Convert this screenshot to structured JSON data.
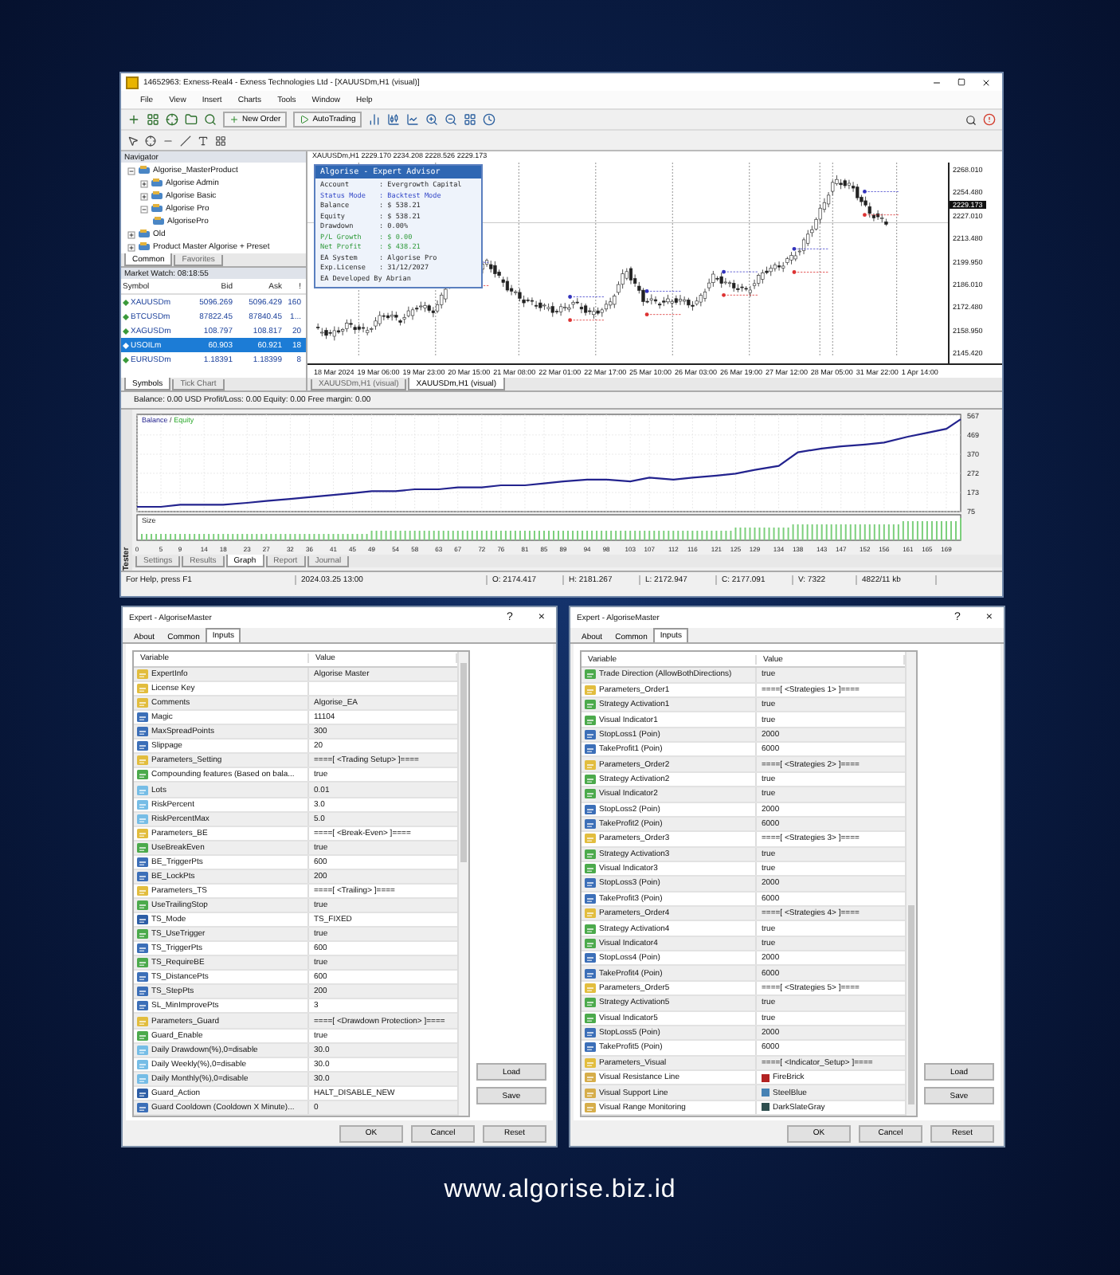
{
  "terminal": {
    "title": "14652963: Exness-Real4 - Exness Technologies Ltd - [XAUUSDm,H1 (visual)]",
    "menu": [
      "File",
      "View",
      "Insert",
      "Charts",
      "Tools",
      "Window",
      "Help"
    ],
    "toolbar_buttons": [
      "New Order",
      "AutoTrading"
    ],
    "navigator": {
      "title": "Navigator",
      "tree": [
        {
          "label": "Algorise_MasterProduct",
          "expanded": true,
          "children": [
            {
              "label": "Algorise Admin",
              "expanded": false
            },
            {
              "label": "Algorise Basic",
              "expanded": false
            },
            {
              "label": "Algorise Pro",
              "expanded": true,
              "children": [
                {
                  "label": "AlgorisePro"
                }
              ]
            }
          ]
        },
        {
          "label": "Old",
          "expanded": false
        },
        {
          "label": "Product Master Algorise + Preset",
          "expanded": false
        }
      ],
      "tabs": [
        {
          "label": "Common",
          "selected": true
        },
        {
          "label": "Favorites",
          "selected": false
        }
      ]
    },
    "market_watch": {
      "title": "Market Watch: 08:18:55",
      "columns": [
        "Symbol",
        "Bid",
        "Ask",
        "!"
      ],
      "rows": [
        {
          "symbol": "XAUUSDm",
          "bid": "5096.269",
          "ask": "5096.429",
          "spread": "160",
          "selected": false
        },
        {
          "symbol": "BTCUSDm",
          "bid": "87822.45",
          "ask": "87840.45",
          "spread": "1...",
          "selected": false
        },
        {
          "symbol": "XAGUSDm",
          "bid": "108.797",
          "ask": "108.817",
          "spread": "20",
          "selected": false
        },
        {
          "symbol": "USOILm",
          "bid": "60.903",
          "ask": "60.921",
          "spread": "18",
          "selected": true
        },
        {
          "symbol": "EURUSDm",
          "bid": "1.18391",
          "ask": "1.18399",
          "spread": "8",
          "selected": false
        }
      ],
      "tabs": [
        {
          "label": "Symbols",
          "selected": true
        },
        {
          "label": "Tick Chart",
          "selected": false
        }
      ]
    },
    "chart": {
      "header": "XAUUSDm,H1  2229.170 2234.208 2228.526 2229.173",
      "price_labels": [
        "2268.010",
        "2254.480",
        "2227.010",
        "2213.480",
        "2199.950",
        "2186.010",
        "2172.480",
        "2158.950",
        "2145.420"
      ],
      "current_price": "2229.173",
      "time_labels": [
        "18 Mar 2024",
        "19 Mar 06:00",
        "19 Mar 23:00",
        "20 Mar 15:00",
        "21 Mar 08:00",
        "22 Mar 01:00",
        "22 Mar 17:00",
        "25 Mar 10:00",
        "26 Mar 03:00",
        "26 Mar 19:00",
        "27 Mar 12:00",
        "28 Mar 05:00",
        "31 Mar 22:00",
        "1 Apr 14:00"
      ],
      "tabs": [
        {
          "label": "XAUUSDm,H1 (visual)",
          "selected": false
        },
        {
          "label": "XAUUSDm,H1 (visual)",
          "selected": true
        }
      ]
    },
    "ea_panel": {
      "title": "Algorise - Expert Advisor",
      "lines": [
        {
          "label": "Account",
          "value": ": Evergrowth Capital",
          "kind": "normal"
        },
        {
          "label": "Status Mode",
          "value": ": Backtest Mode",
          "kind": "status"
        },
        {
          "label": "Balance",
          "value": ": $ 538.21",
          "kind": "normal"
        },
        {
          "label": "Equity",
          "value": ": $ 538.21",
          "kind": "normal"
        },
        {
          "label": "Drawdown",
          "value": ": 0.00%",
          "kind": "normal"
        },
        {
          "label": "P/L Growth",
          "value": ": $ 0.00",
          "kind": "profit"
        },
        {
          "label": "Net Profit",
          "value": ": $ 438.21",
          "kind": "profit"
        },
        {
          "label": "EA System",
          "value": ": Algorise Pro",
          "kind": "normal"
        },
        {
          "label": "Exp.License",
          "value": ": 31/12/2027",
          "kind": "normal"
        },
        {
          "label": "EA Developed By Abrian",
          "kind": "normal"
        }
      ]
    },
    "account_bar": "Balance: 0.00 USD  Profit/Loss: 0.00  Equity: 0.00  Free margin: 0.00",
    "tester": {
      "side_label": "Tester",
      "legend_separator": "/",
      "equity_label": "Equity",
      "size_label": "Size",
      "chart_data": {
        "type": "line",
        "x": [
          0,
          5,
          9,
          14,
          18,
          23,
          27,
          32,
          36,
          41,
          45,
          49,
          54,
          58,
          63,
          67,
          72,
          76,
          81,
          85,
          89,
          94,
          98,
          103,
          107,
          112,
          116,
          121,
          125,
          129,
          134,
          138,
          143,
          147,
          152,
          156,
          161,
          165,
          169,
          172
        ],
        "series": [
          {
            "name": "Balance",
            "color": "#23238e",
            "values": [
              100,
              100,
              110,
              110,
              110,
              120,
              130,
              140,
              150,
              160,
              170,
              180,
              180,
              190,
              190,
              200,
              200,
              210,
              210,
              220,
              230,
              240,
              240,
              230,
              250,
              240,
              250,
              260,
              270,
              290,
              310,
              380,
              400,
              410,
              420,
              430,
              460,
              480,
              500,
              550
            ]
          }
        ],
        "xlim": [
          0,
          172
        ],
        "ylim": [
          75,
          575
        ],
        "xticks": [
          0,
          5,
          9,
          14,
          18,
          23,
          27,
          32,
          36,
          41,
          45,
          49,
          54,
          58,
          63,
          67,
          72,
          76,
          81,
          85,
          89,
          94,
          98,
          103,
          107,
          112,
          116,
          121,
          125,
          129,
          134,
          138,
          143,
          147,
          152,
          156,
          161,
          165,
          169
        ],
        "yticks": [
          75,
          173,
          272,
          370,
          469,
          567
        ],
        "grid": true
      },
      "tabs": [
        {
          "label": "Settings",
          "selected": false
        },
        {
          "label": "Results",
          "selected": false
        },
        {
          "label": "Graph",
          "selected": true
        },
        {
          "label": "Report",
          "selected": false
        },
        {
          "label": "Journal",
          "selected": false
        }
      ]
    },
    "status_bar": [
      "For Help, press F1",
      "2024.03.25 13:00",
      "O: 2174.417",
      "H: 2181.267",
      "L: 2172.947",
      "C: 2177.091",
      "V: 7322",
      "4822/11 kb"
    ]
  },
  "dialogs": [
    {
      "title": "Expert - AlgoriseMaster",
      "help": "?",
      "close": "×",
      "tabs": [
        {
          "label": "About",
          "selected": false
        },
        {
          "label": "Common",
          "selected": false
        },
        {
          "label": "Inputs",
          "selected": true
        }
      ],
      "columns": [
        "Variable",
        "Value"
      ],
      "rows": [
        {
          "kind": "string",
          "name": "ExpertInfo",
          "value": "Algorise Master"
        },
        {
          "kind": "string",
          "name": "License Key"
        },
        {
          "kind": "string",
          "name": "Comments",
          "value": "Algorise_EA"
        },
        {
          "kind": "int",
          "name": "Magic",
          "value": "11104"
        },
        {
          "kind": "int",
          "name": "MaxSpreadPoints",
          "value": "300"
        },
        {
          "kind": "int",
          "name": "Slippage",
          "value": "20"
        },
        {
          "kind": "string",
          "name": "Parameters_Setting",
          "value": "====[ <Trading Setup> ]===="
        },
        {
          "kind": "bool",
          "name": "Compounding features (Based on bala...",
          "value": "true"
        },
        {
          "kind": "double",
          "name": "Lots",
          "value": "0.01"
        },
        {
          "kind": "double",
          "name": "RiskPercent",
          "value": "3.0"
        },
        {
          "kind": "double",
          "name": "RiskPercentMax",
          "value": "5.0"
        },
        {
          "kind": "string",
          "name": "Parameters_BE",
          "value": "====[ <Break-Even> ]===="
        },
        {
          "kind": "bool",
          "name": "UseBreakEven",
          "value": "true"
        },
        {
          "kind": "int",
          "name": "BE_TriggerPts",
          "value": "600"
        },
        {
          "kind": "int",
          "name": "BE_LockPts",
          "value": "200"
        },
        {
          "kind": "string",
          "name": "Parameters_TS",
          "value": "====[ <Trailing> ]===="
        },
        {
          "kind": "bool",
          "name": "UseTrailingStop",
          "value": "true"
        },
        {
          "kind": "enum",
          "name": "TS_Mode",
          "value": "TS_FIXED"
        },
        {
          "kind": "bool",
          "name": "TS_UseTrigger",
          "value": "true"
        },
        {
          "kind": "int",
          "name": "TS_TriggerPts",
          "value": "600"
        },
        {
          "kind": "bool",
          "name": "TS_RequireBE",
          "value": "true"
        },
        {
          "kind": "int",
          "name": "TS_DistancePts",
          "value": "600"
        },
        {
          "kind": "int",
          "name": "TS_StepPts",
          "value": "200"
        },
        {
          "kind": "int",
          "name": "SL_MinImprovePts",
          "value": "3"
        },
        {
          "kind": "string",
          "name": "Parameters_Guard",
          "value": "====[ <Drawdown Protection> ]===="
        },
        {
          "kind": "bool",
          "name": "Guard_Enable",
          "value": "true"
        },
        {
          "kind": "double",
          "name": "Daily Drawdown(%),0=disable",
          "value": "30.0"
        },
        {
          "kind": "double",
          "name": "Daily Weekly(%),0=disable",
          "value": "30.0"
        },
        {
          "kind": "double",
          "name": "Daily Monthly(%),0=disable",
          "value": "30.0"
        },
        {
          "kind": "enum",
          "name": "Guard_Action",
          "value": "HALT_DISABLE_NEW"
        },
        {
          "kind": "int",
          "name": "Guard Cooldown (Cooldown X Minute)...",
          "value": "0"
        }
      ],
      "side_buttons": [
        "Load",
        "Save"
      ],
      "buttons": [
        "OK",
        "Cancel",
        "Reset"
      ]
    },
    {
      "title": "Expert - AlgoriseMaster",
      "help": "?",
      "close": "×",
      "tabs": [
        {
          "label": "About",
          "selected": false
        },
        {
          "label": "Common",
          "selected": false
        },
        {
          "label": "Inputs",
          "selected": true
        }
      ],
      "columns": [
        "Variable",
        "Value"
      ],
      "rows": [
        {
          "kind": "bool",
          "name": "Trade Direction (AllowBothDirections)",
          "value": "true"
        },
        {
          "kind": "string",
          "name": "Parameters_Order1",
          "value": "====[ <Strategies 1> ]===="
        },
        {
          "kind": "bool",
          "name": "Strategy Activation1",
          "value": "true"
        },
        {
          "kind": "bool",
          "name": "Visual Indicator1",
          "value": "true"
        },
        {
          "kind": "int",
          "name": "StopLoss1 (Poin)",
          "value": "2000"
        },
        {
          "kind": "int",
          "name": "TakeProfit1 (Poin)",
          "value": "6000"
        },
        {
          "kind": "string",
          "name": "Parameters_Order2",
          "value": "====[ <Strategies 2> ]===="
        },
        {
          "kind": "bool",
          "name": "Strategy Activation2",
          "value": "true"
        },
        {
          "kind": "bool",
          "name": "Visual Indicator2",
          "value": "true"
        },
        {
          "kind": "int",
          "name": "StopLoss2 (Poin)",
          "value": "2000"
        },
        {
          "kind": "int",
          "name": "TakeProfit2 (Poin)",
          "value": "6000"
        },
        {
          "kind": "string",
          "name": "Parameters_Order3",
          "value": "====[ <Strategies 3> ]===="
        },
        {
          "kind": "bool",
          "name": "Strategy Activation3",
          "value": "true"
        },
        {
          "kind": "bool",
          "name": "Visual Indicator3",
          "value": "true"
        },
        {
          "kind": "int",
          "name": "StopLoss3 (Poin)",
          "value": "2000"
        },
        {
          "kind": "int",
          "name": "TakeProfit3 (Poin)",
          "value": "6000"
        },
        {
          "kind": "string",
          "name": "Parameters_Order4",
          "value": "====[ <Strategies 4> ]===="
        },
        {
          "kind": "bool",
          "name": "Strategy Activation4",
          "value": "true"
        },
        {
          "kind": "bool",
          "name": "Visual Indicator4",
          "value": "true"
        },
        {
          "kind": "int",
          "name": "StopLoss4 (Poin)",
          "value": "2000"
        },
        {
          "kind": "int",
          "name": "TakeProfit4 (Poin)",
          "value": "6000"
        },
        {
          "kind": "string",
          "name": "Parameters_Order5",
          "value": "====[ <Strategies 5> ]===="
        },
        {
          "kind": "bool",
          "name": "Strategy Activation5",
          "value": "true"
        },
        {
          "kind": "bool",
          "name": "Visual Indicator5",
          "value": "true"
        },
        {
          "kind": "int",
          "name": "StopLoss5 (Poin)",
          "value": "2000"
        },
        {
          "kind": "int",
          "name": "TakeProfit5 (Poin)",
          "value": "6000"
        },
        {
          "kind": "string",
          "name": "Parameters_Visual",
          "value": "====[ <Indicator_Setup> ]===="
        },
        {
          "kind": "color",
          "name": "Visual Resistance Line",
          "value": "FireBrick",
          "color": "#b22222"
        },
        {
          "kind": "color",
          "name": "Visual Support Line",
          "value": "SteelBlue",
          "color": "#4682b4"
        },
        {
          "kind": "color",
          "name": "Visual Range Monitoring",
          "value": "DarkSlateGray",
          "color": "#2f4f4f"
        }
      ],
      "side_buttons": [
        "Load",
        "Save"
      ],
      "buttons": [
        "OK",
        "Cancel",
        "Reset"
      ]
    }
  ],
  "footer": "www.algorise.biz.id"
}
